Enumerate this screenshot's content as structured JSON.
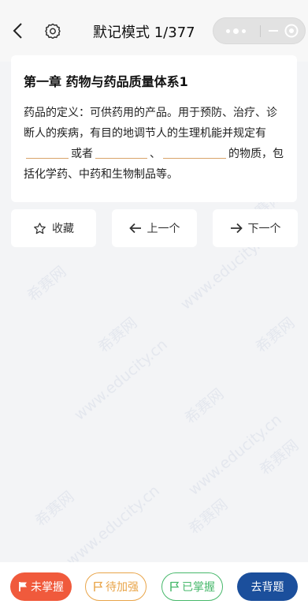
{
  "header": {
    "title": "默记模式 1/377"
  },
  "card": {
    "chapter": "第一章 药物与药品质量体系1",
    "definition": {
      "part1": "药品的定义：可供药用的产品。用于预防、治疗、诊断人的疾病，有目的地调节人的生理机能并规定有",
      "part2": "或者",
      "part3": "、",
      "part4": "的物质，包括化学药、中药和生物制品等。"
    }
  },
  "nav": {
    "favorite": "收藏",
    "prev": "上一个",
    "next": "下一个"
  },
  "footer": {
    "not_mastered": "未掌握",
    "to_strengthen": "待加强",
    "mastered": "已掌握",
    "recite": "去背题"
  },
  "watermark": {
    "brand": "希赛网",
    "url": "www.educity.cn"
  },
  "colors": {
    "not_mastered": "#f05a3c",
    "to_strengthen": "#e9a54a",
    "mastered": "#47b86b",
    "recite": "#1b4f9c",
    "blank_underline": "#d9a46a"
  }
}
